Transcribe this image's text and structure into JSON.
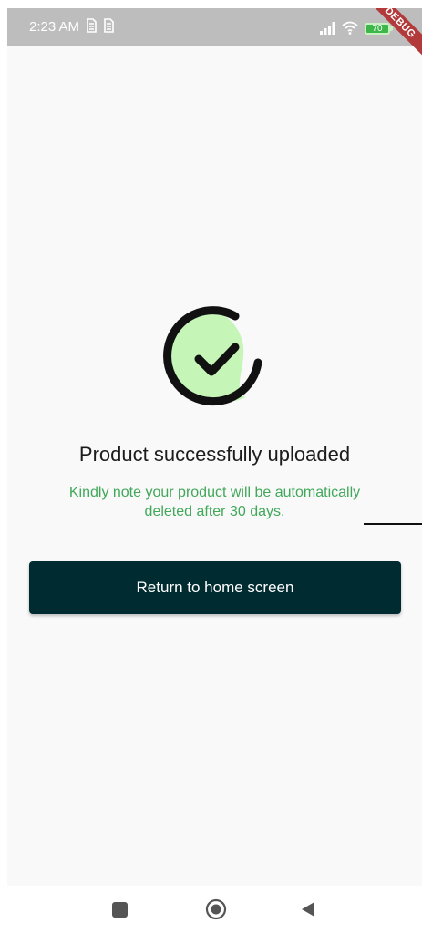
{
  "status_bar": {
    "time": "2:23 AM",
    "battery_level": "70",
    "icons": [
      "sim-icon",
      "sim-icon",
      "signal-icon",
      "wifi-icon",
      "battery-icon"
    ]
  },
  "debug_banner": {
    "label": "DEBUG"
  },
  "main": {
    "icon": "check-circle-icon",
    "title": "Product successfully uploaded",
    "note": "Kindly note your product will be automatically deleted after 30 days.",
    "button_label": "Return to home screen"
  },
  "colors": {
    "accent_green": "#41a85a",
    "button_bg": "#002b31",
    "icon_fill": "#c6f5b8"
  },
  "nav_bar": {
    "icons": [
      "recents-icon",
      "home-icon",
      "back-icon"
    ]
  }
}
